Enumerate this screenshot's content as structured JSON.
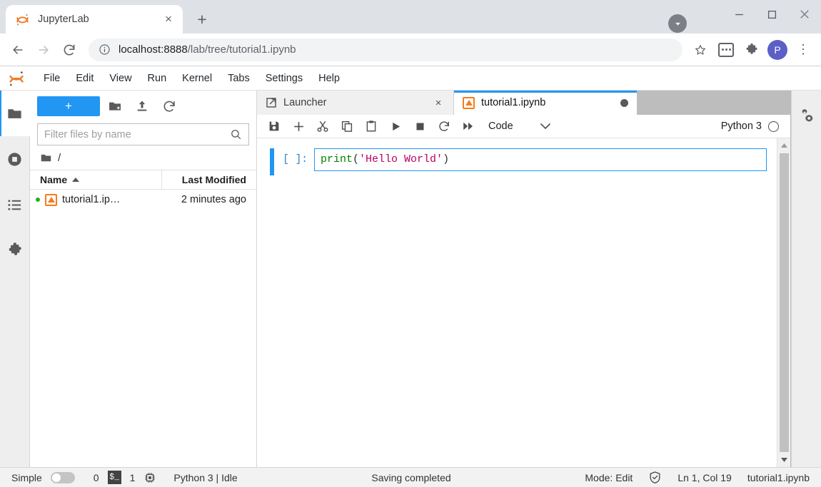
{
  "browser": {
    "tab": {
      "title": "JupyterLab",
      "favicon": "jupyter-logo-icon",
      "close": "×"
    },
    "newtab_label": "+",
    "window_controls": {
      "minimize": "—",
      "maximize": "□",
      "close": "×"
    },
    "download_icon": "download-circle-icon",
    "nav": {
      "back": "←",
      "forward": "→",
      "reload": "↻"
    },
    "omnibox": {
      "info_icon": "info-circle-icon",
      "host": "localhost:8888",
      "path": "/lab/tree/tutorial1.ipynb",
      "bookmark_icon": "star-icon"
    },
    "actions": {
      "menu_box": "extensions-menu-icon",
      "puzzle": "extensions-puzzle-icon",
      "avatar": "P",
      "overflow": "⋮"
    }
  },
  "jupyter": {
    "menubar": {
      "logo": "jupyter-logo-icon",
      "items": [
        {
          "label": "File"
        },
        {
          "label": "Edit"
        },
        {
          "label": "View"
        },
        {
          "label": "Run"
        },
        {
          "label": "Kernel"
        },
        {
          "label": "Tabs"
        },
        {
          "label": "Settings"
        },
        {
          "label": "Help"
        }
      ]
    },
    "activity_bar": [
      {
        "name": "file-browser",
        "icon": "folder-icon",
        "active": true
      },
      {
        "name": "running-sessions",
        "icon": "stop-circle-icon",
        "active": false
      },
      {
        "name": "commands",
        "icon": "list-icon",
        "active": false
      },
      {
        "name": "extensions",
        "icon": "puzzle-icon",
        "active": false
      }
    ],
    "file_browser": {
      "new_launcher_label": "+",
      "new_folder_icon": "new-folder-icon",
      "upload_icon": "upload-icon",
      "refresh_icon": "refresh-icon",
      "filter_placeholder": "Filter files by name",
      "filter_value": "",
      "search_icon": "search-icon",
      "breadcrumb": "/",
      "breadcrumb_icon": "folder-icon",
      "columns": {
        "name": "Name",
        "last_modified": "Last Modified",
        "sort_icon": "sort-ascending-icon"
      },
      "files": [
        {
          "name": "tutorial1.ip…",
          "modified": "2 minutes ago",
          "running": true,
          "icon": "notebook-icon"
        }
      ]
    },
    "dock_tabs": [
      {
        "label": "Launcher",
        "icon": "launcher-icon",
        "active": false,
        "closable": true,
        "close": "×"
      },
      {
        "label": "tutorial1.ipynb",
        "icon": "notebook-icon",
        "active": true,
        "dirty": true
      }
    ],
    "notebook_toolbar": {
      "buttons": [
        {
          "name": "save-button",
          "icon": "save-icon"
        },
        {
          "name": "insert-cell-button",
          "icon": "plus-icon"
        },
        {
          "name": "cut-button",
          "icon": "scissors-icon"
        },
        {
          "name": "copy-button",
          "icon": "copy-icon"
        },
        {
          "name": "paste-button",
          "icon": "clipboard-icon"
        },
        {
          "name": "run-button",
          "icon": "play-icon"
        },
        {
          "name": "interrupt-button",
          "icon": "stop-icon"
        },
        {
          "name": "restart-button",
          "icon": "restart-icon"
        },
        {
          "name": "restart-run-all-button",
          "icon": "fast-forward-icon"
        }
      ],
      "cell_type": "Code",
      "cell_type_chevron": "⌄",
      "kernel_name": "Python 3",
      "kernel_status_icon": "kernel-idle-circle-icon"
    },
    "cells": [
      {
        "prompt": "[ ]:",
        "tokens": [
          {
            "t": "print",
            "k": "fn"
          },
          {
            "t": "(",
            "k": "punc"
          },
          {
            "t": "'Hello World'",
            "k": "str"
          },
          {
            "t": ")",
            "k": "punc"
          }
        ]
      }
    ],
    "scrollbar": {
      "up": "▲",
      "down": "▼"
    },
    "right_sidebar": [
      {
        "name": "property-inspector",
        "icon": "gears-icon"
      }
    ],
    "status_bar": {
      "simple_label": "Simple",
      "simple_on": false,
      "terminals_count": "0",
      "terminal_icon": "$_",
      "kernels_count": "1",
      "kernel_icon": "cpu-chip-icon",
      "kernel_status": "Python 3 | Idle",
      "save_status": "Saving completed",
      "mode": "Mode: Edit",
      "trust_icon": "trusted-shield-icon",
      "cursor_position": "Ln 1, Col 19",
      "filename": "tutorial1.ipynb"
    }
  }
}
